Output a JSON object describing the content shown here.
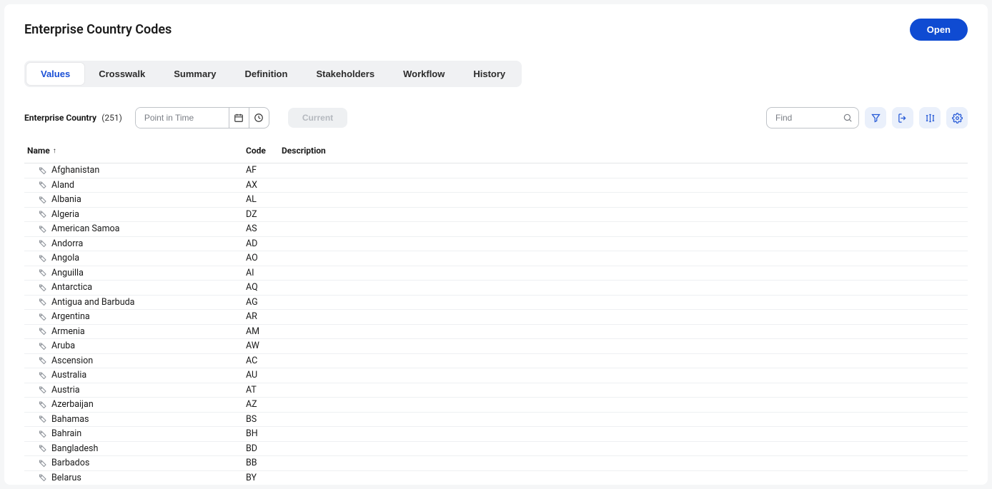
{
  "header": {
    "title": "Enterprise Country Codes",
    "open_label": "Open"
  },
  "tabs": [
    {
      "label": "Values",
      "active": true
    },
    {
      "label": "Crosswalk",
      "active": false
    },
    {
      "label": "Summary",
      "active": false
    },
    {
      "label": "Definition",
      "active": false
    },
    {
      "label": "Stakeholders",
      "active": false
    },
    {
      "label": "Workflow",
      "active": false
    },
    {
      "label": "History",
      "active": false
    }
  ],
  "toolbar": {
    "section_label": "Enterprise Country",
    "count": "(251)",
    "point_in_time_placeholder": "Point in Time",
    "current_label": "Current",
    "find_placeholder": "Find"
  },
  "columns": {
    "name": "Name",
    "code": "Code",
    "description": "Description"
  },
  "sort_indicator": "↑",
  "rows": [
    {
      "name": "Afghanistan",
      "code": "AF",
      "description": ""
    },
    {
      "name": "Aland",
      "code": "AX",
      "description": ""
    },
    {
      "name": "Albania",
      "code": "AL",
      "description": ""
    },
    {
      "name": "Algeria",
      "code": "DZ",
      "description": ""
    },
    {
      "name": "American Samoa",
      "code": "AS",
      "description": ""
    },
    {
      "name": "Andorra",
      "code": "AD",
      "description": ""
    },
    {
      "name": "Angola",
      "code": "AO",
      "description": ""
    },
    {
      "name": "Anguilla",
      "code": "AI",
      "description": ""
    },
    {
      "name": "Antarctica",
      "code": "AQ",
      "description": ""
    },
    {
      "name": "Antigua and Barbuda",
      "code": "AG",
      "description": ""
    },
    {
      "name": "Argentina",
      "code": "AR",
      "description": ""
    },
    {
      "name": "Armenia",
      "code": "AM",
      "description": ""
    },
    {
      "name": "Aruba",
      "code": "AW",
      "description": ""
    },
    {
      "name": "Ascension",
      "code": "AC",
      "description": ""
    },
    {
      "name": "Australia",
      "code": "AU",
      "description": ""
    },
    {
      "name": "Austria",
      "code": "AT",
      "description": ""
    },
    {
      "name": "Azerbaijan",
      "code": "AZ",
      "description": ""
    },
    {
      "name": "Bahamas",
      "code": "BS",
      "description": ""
    },
    {
      "name": "Bahrain",
      "code": "BH",
      "description": ""
    },
    {
      "name": "Bangladesh",
      "code": "BD",
      "description": ""
    },
    {
      "name": "Barbados",
      "code": "BB",
      "description": ""
    },
    {
      "name": "Belarus",
      "code": "BY",
      "description": ""
    }
  ]
}
